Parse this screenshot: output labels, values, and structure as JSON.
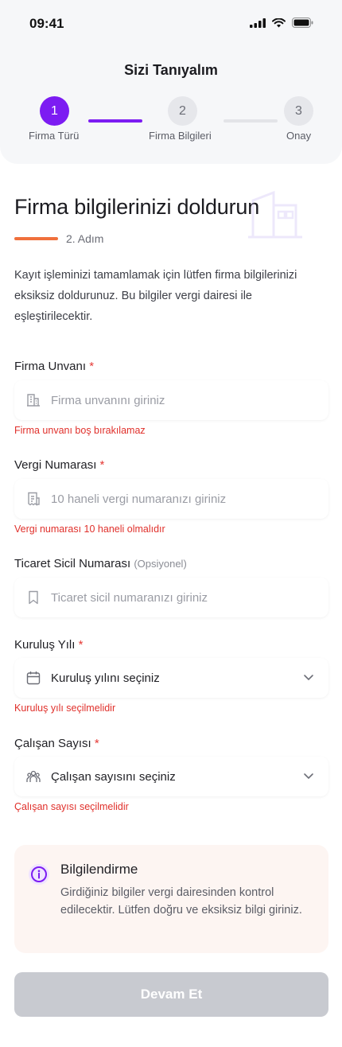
{
  "status": {
    "time": "09:41"
  },
  "header": {
    "title": "Sizi Tanıyalım"
  },
  "steps": [
    {
      "number": "1",
      "label": "Firma Türü",
      "state": "active"
    },
    {
      "number": "2",
      "label": "Firma Bilgileri",
      "state": "current"
    },
    {
      "number": "3",
      "label": "Onay",
      "state": "upcoming"
    }
  ],
  "page": {
    "title": "Firma bilgilerinizi doldurun",
    "step_caption": "2. Adım",
    "intro": "Kayıt işleminizi tamamlamak için lütfen firma bilgilerinizi eksiksiz doldurunuz. Bu bilgiler vergi dairesi ile eşleştirilecektir."
  },
  "fields": {
    "company_name": {
      "label": "Firma Unvanı",
      "required": "*",
      "placeholder": "Firma unvanını giriniz",
      "error": "Firma unvanı boş bırakılamaz",
      "icon": "building-icon"
    },
    "tax_number": {
      "label": "Vergi Numarası",
      "required": "*",
      "placeholder": "10 haneli vergi numaranızı giriniz",
      "error": "Vergi numarası 10 haneli olmalıdır",
      "icon": "receipt-icon"
    },
    "trade_registry": {
      "label": "Ticaret Sicil Numarası",
      "optional": "(Opsiyonel)",
      "placeholder": "Ticaret sicil numaranızı giriniz",
      "icon": "bookmark-icon"
    },
    "founding_year": {
      "label": "Kuruluş Yılı",
      "required": "*",
      "value": "Kuruluş yılını seçiniz",
      "error": "Kuruluş yılı seçilmelidir",
      "icon": "calendar-icon"
    },
    "employee_count": {
      "label": "Çalışan Sayısı",
      "required": "*",
      "value": "Çalışan sayısını seçiniz",
      "error": "Çalışan sayısı seçilmelidir",
      "icon": "users-icon"
    }
  },
  "info": {
    "title": "Bilgilendirme",
    "text": "Girdiğiniz bilgiler vergi dairesinden kontrol edilecektir. Lütfen doğru ve eksiksiz bilgi giriniz."
  },
  "cta": {
    "label": "Devam Et"
  },
  "colors": {
    "accent": "#7c1cf2",
    "error": "#e0302b",
    "orange": "#f0703c"
  }
}
